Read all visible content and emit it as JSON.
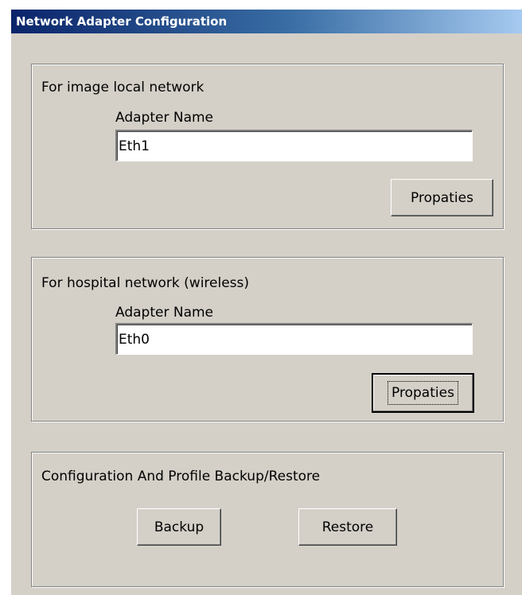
{
  "window": {
    "title": "Network Adapter Configuration"
  },
  "local_group": {
    "label": "For image local network",
    "adapter_label": "Adapter Name",
    "adapter_value": "Eth1",
    "properties_button": "Propaties"
  },
  "hospital_group": {
    "label": "For hospital network (wireless)",
    "adapter_label": "Adapter Name",
    "adapter_value": "Eth0",
    "properties_button": "Propaties"
  },
  "backup_group": {
    "label": "Configuration And Profile Backup/Restore",
    "backup_button": "Backup",
    "restore_button": "Restore"
  }
}
